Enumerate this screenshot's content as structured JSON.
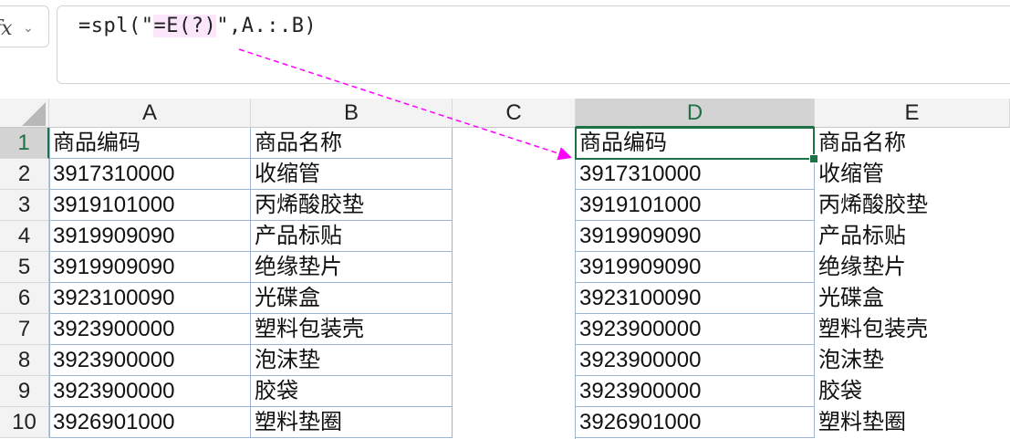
{
  "formula_bar": {
    "fx_label": "fx",
    "chevron": "⌄",
    "formula_prefix": "=spl(\"",
    "formula_highlight": "=E(?)",
    "formula_suffix": "\",A.:.B)"
  },
  "columns": {
    "A": "A",
    "B": "B",
    "C": "C",
    "D": "D",
    "E": "E"
  },
  "rows": [
    "1",
    "2",
    "3",
    "4",
    "5",
    "6",
    "7",
    "8",
    "9",
    "10"
  ],
  "left_table": {
    "codes": [
      "商品编码",
      "3917310000",
      "3919101000",
      "3919909090",
      "3919909090",
      "3923100090",
      "3923900000",
      "3923900000",
      "3923900000",
      "3926901000"
    ],
    "names": [
      "商品名称",
      "收缩管",
      "丙烯酸胶垫",
      "产品标贴",
      "绝缘垫片",
      "光碟盒",
      "塑料包装壳",
      "泡沫垫",
      "胶袋",
      "塑料垫圈"
    ]
  },
  "right_table": {
    "codes": [
      "商品编码",
      "3917310000",
      "3919101000",
      "3919909090",
      "3919909090",
      "3923100090",
      "3923900000",
      "3923900000",
      "3923900000",
      "3926901000"
    ],
    "names": [
      "商品名称",
      "收缩管",
      "丙烯酸胶垫",
      "产品标贴",
      "绝缘垫片",
      "光碟盒",
      "塑料包装壳",
      "泡沫垫",
      "胶袋",
      "塑料垫圈"
    ]
  },
  "colors": {
    "selection": "#1e7145",
    "arrow": "#ff00ff",
    "table_border": "#9bb4cf"
  },
  "active_cell": "D1"
}
